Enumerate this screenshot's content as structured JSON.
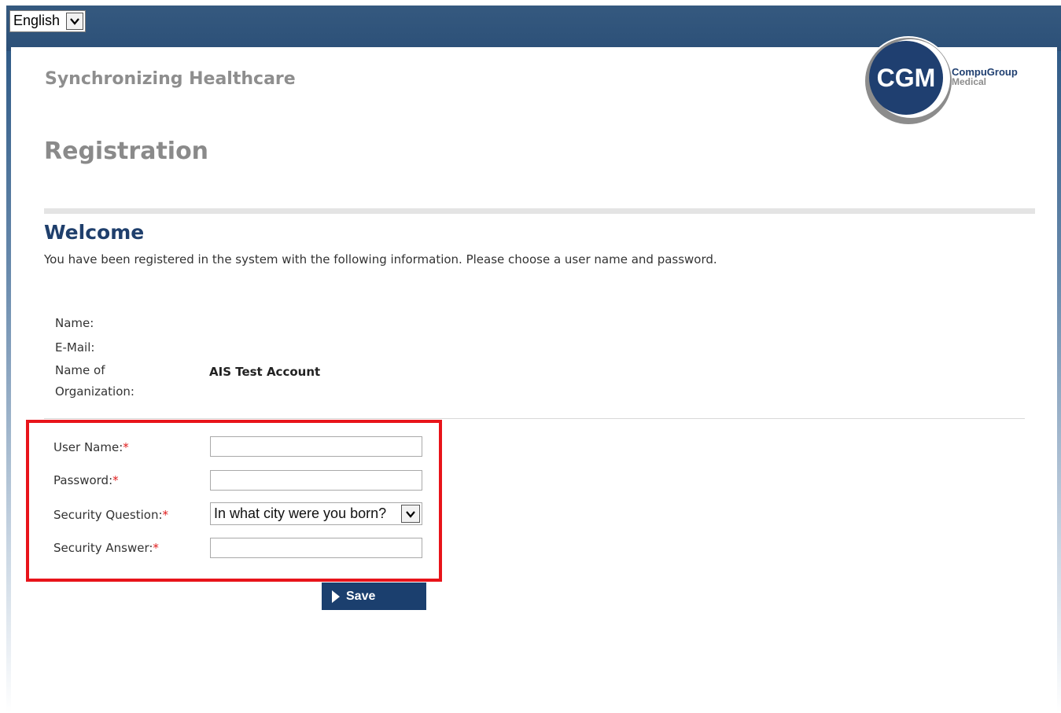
{
  "language_selector": {
    "selected": "English"
  },
  "header": {
    "tagline": "Synchronizing Healthcare",
    "page_title": "Registration",
    "logo": {
      "mark": "CGM",
      "name_line1": "CompuGroup",
      "name_line2": "Medical",
      "colors": {
        "circle": "#1f3f70",
        "ring": "#8c8c8c"
      }
    }
  },
  "welcome": {
    "heading": "Welcome",
    "intro": "You have been registered in the system with the following information. Please choose a user name and password."
  },
  "registered_info": {
    "name_label": "Name:",
    "name_value": "",
    "email_label": "E-Mail:",
    "email_value": "",
    "organization_label_line1": "Name of",
    "organization_label_line2": "Organization:",
    "organization_value": "AIS Test Account"
  },
  "form": {
    "required_marker": "*",
    "username": {
      "label": "User Name:",
      "value": ""
    },
    "password": {
      "label": "Password:",
      "value": ""
    },
    "security_question": {
      "label": "Security Question:",
      "selected": "In what city were you born?"
    },
    "security_answer": {
      "label": "Security Answer:",
      "value": ""
    },
    "save_label": "Save"
  },
  "colors": {
    "header_band": "#2f5a86",
    "welcome_heading": "#1f3f6c",
    "save_button": "#1b3f6e",
    "highlight_border": "#e8141a",
    "required_marker": "#e01b1b"
  }
}
